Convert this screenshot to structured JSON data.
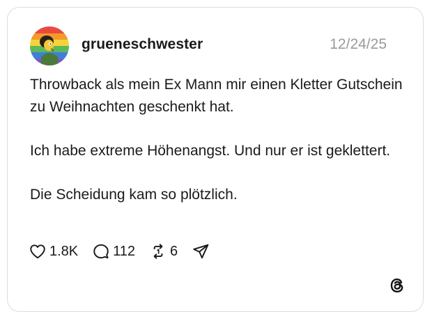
{
  "post": {
    "username": "grueneschwester",
    "date": "12/24/25",
    "paragraphs": [
      "Throwback als mein Ex Mann mir einen Kletter Gutschein zu Weihnachten geschenkt hat.",
      "Ich habe extreme Höhenangst. Und nur er ist geklettert.",
      "Die Scheidung kam so plötzlich."
    ]
  },
  "actions": {
    "likes": "1.8K",
    "replies": "112",
    "reposts": "6"
  },
  "icons": {
    "like": "heart-icon",
    "reply": "speech-bubble-icon",
    "repost": "repost-icon",
    "share": "send-icon",
    "brand": "threads-logo-icon"
  }
}
